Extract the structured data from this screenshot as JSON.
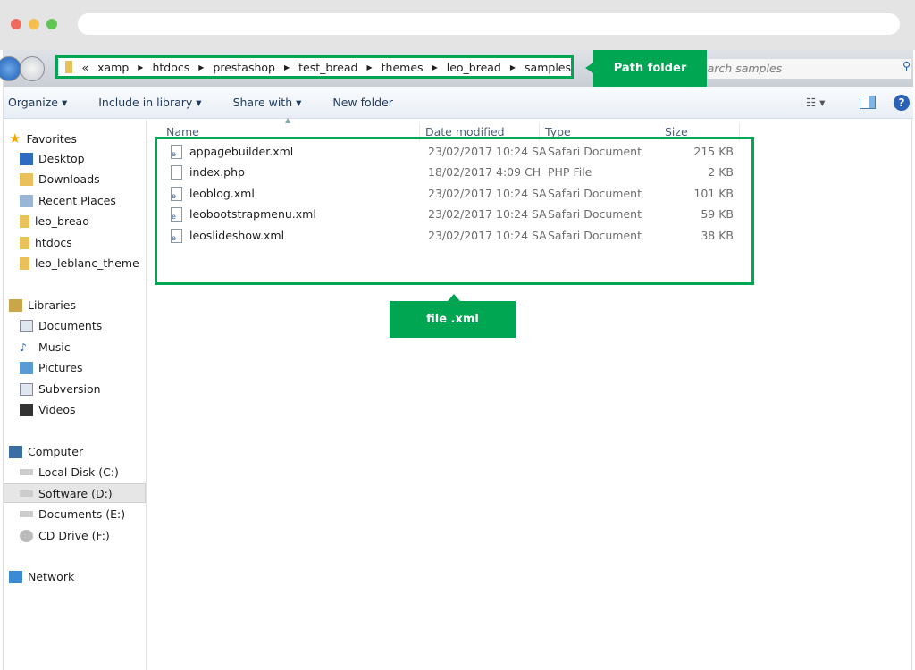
{
  "colors": {
    "accent": "#00a651",
    "close": "#ed6a5e",
    "minimize": "#f5bf4f",
    "maximize": "#61c554"
  },
  "address": {
    "prefix": "«",
    "crumbs": [
      "xamp",
      "htdocs",
      "prestashop",
      "test_bread",
      "themes",
      "leo_bread",
      "samples"
    ]
  },
  "search": {
    "placeholder": "Search samples",
    "visible": "arch samples"
  },
  "callouts": {
    "path": "Path folder",
    "file": "file .xml"
  },
  "toolbar": {
    "organize": "Organize",
    "include": "Include in library",
    "share": "Share with",
    "new_folder": "New folder"
  },
  "sidebar": {
    "favorites": {
      "label": "Favorites",
      "items": [
        "Desktop",
        "Downloads",
        "Recent Places",
        "leo_bread",
        "htdocs",
        "leo_leblanc_theme"
      ]
    },
    "libraries": {
      "label": "Libraries",
      "items": [
        "Documents",
        "Music",
        "Pictures",
        "Subversion",
        "Videos"
      ]
    },
    "computer": {
      "label": "Computer",
      "items": [
        "Local Disk (C:)",
        "Software (D:)",
        "Documents (E:)",
        "CD Drive (F:)"
      ]
    },
    "network": {
      "label": "Network"
    }
  },
  "columns": {
    "name": "Name",
    "date": "Date modified",
    "type": "Type",
    "size": "Size"
  },
  "files": [
    {
      "name": "appagebuilder.xml",
      "date": "23/02/2017 10:24 SA",
      "type": "Safari Document",
      "size": "215 KB"
    },
    {
      "name": "index.php",
      "date": "18/02/2017 4:09 CH",
      "type": "PHP File",
      "size": "2 KB"
    },
    {
      "name": "leoblog.xml",
      "date": "23/02/2017 10:24 SA",
      "type": "Safari Document",
      "size": "101 KB"
    },
    {
      "name": "leobootstrapmenu.xml",
      "date": "23/02/2017 10:24 SA",
      "type": "Safari Document",
      "size": "59 KB"
    },
    {
      "name": "leoslideshow.xml",
      "date": "23/02/2017 10:24 SA",
      "type": "Safari Document",
      "size": "38 KB"
    }
  ]
}
